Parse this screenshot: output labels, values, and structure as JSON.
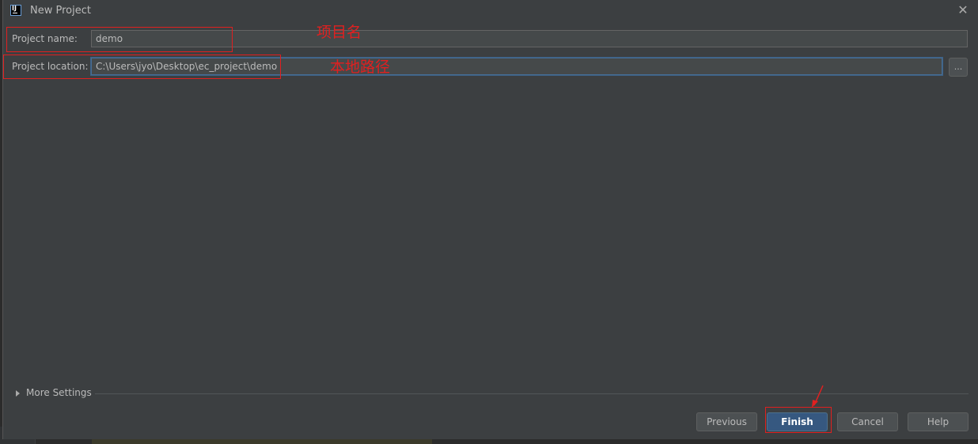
{
  "window": {
    "title": "New Project",
    "app_icon": "intellij-idea-icon"
  },
  "form": {
    "name_label": "Project name:",
    "name_value": "demo",
    "location_label": "Project location:",
    "location_value": "C:\\Users\\jyo\\Desktop\\ec_project\\demo",
    "browse_label": "..."
  },
  "annotations": {
    "name_note": "项目名",
    "location_note": "本地路径",
    "color": "#e02020"
  },
  "more_settings_label": "More Settings",
  "buttons": {
    "previous": "Previous",
    "finish": "Finish",
    "cancel": "Cancel",
    "help": "Help"
  },
  "colors": {
    "background": "#3c3f41",
    "field": "#45494a",
    "primary_button": "#365880",
    "focus_border": "#466d94"
  }
}
